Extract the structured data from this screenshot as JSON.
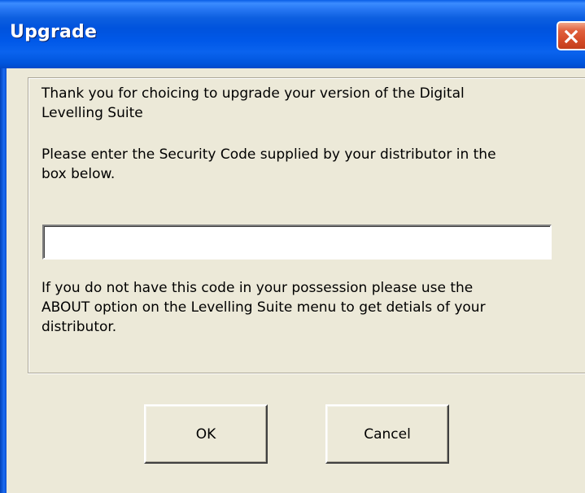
{
  "window": {
    "title": "Upgrade",
    "close_icon": "close-icon"
  },
  "content": {
    "thanks_text": "Thank you for choicing to upgrade your version of the Digital\nLevelling Suite",
    "instruction_text": "Please enter the Security Code supplied by your distributor in the\nbox below.",
    "security_code_value": "",
    "help_text": "If you do not have this code in your possession please use the\nABOUT option on the Levelling Suite menu to get detials of your\ndistributor."
  },
  "buttons": {
    "ok_label": "OK",
    "cancel_label": "Cancel"
  },
  "colors": {
    "titlebar": "#0055dc",
    "face": "#ece9d8",
    "close_button": "#d34a26"
  }
}
